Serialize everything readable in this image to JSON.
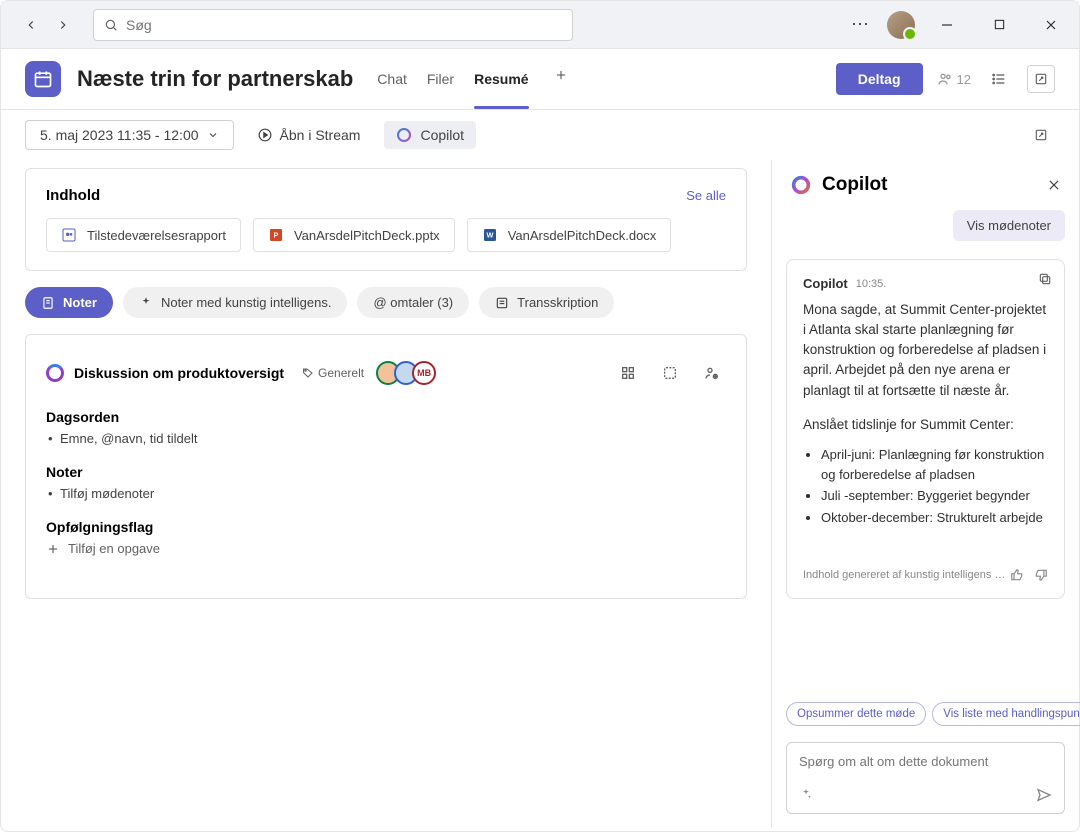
{
  "search": {
    "placeholder": "Søg"
  },
  "window": {
    "participants_count": "12"
  },
  "header": {
    "title": "Næste trin for partnerskab",
    "tabs": {
      "chat": "Chat",
      "files": "Filer",
      "recap": "Resumé"
    },
    "join": "Deltag"
  },
  "toolbar": {
    "date_range": "5. maj 2023 11:35 - 12:00",
    "open_stream": "Åbn i Stream",
    "copilot": "Copilot"
  },
  "content": {
    "heading": "Indhold",
    "see_all": "Se alle",
    "files": [
      {
        "name": "Tilstedeværelsesrapport",
        "type": "teams"
      },
      {
        "name": "VanArsdelPitchDeck.pptx",
        "type": "pptx"
      },
      {
        "name": "VanArsdelPitchDeck.docx",
        "type": "docx"
      }
    ]
  },
  "pills": {
    "notes": "Noter",
    "ai_notes": "Noter med kunstig intelligens.",
    "mentions": "@ omtaler (3)",
    "transcript": "Transskription"
  },
  "notes": {
    "title": "Diskussion om produktoversigt",
    "tag": "Generelt",
    "avatars": {
      "mb": "MB"
    },
    "sections": {
      "agenda_h": "Dagsorden",
      "agenda_item": "Emne, @navn, tid tildelt",
      "notes_h": "Noter",
      "notes_item": "Tilføj mødenoter",
      "followup_h": "Opfølgningsflag",
      "add_task": "Tilføj en opgave"
    }
  },
  "copilot": {
    "title": "Copilot",
    "show_notes": "Vis mødenoter",
    "msg_name": "Copilot",
    "msg_time": "10:35.",
    "msg_body": "Mona sagde, at Summit Center-projektet i Atlanta skal starte planlægning før konstruktion og forberedelse af pladsen i april. Arbejdet på den nye arena er planlagt til at fortsætte til næste år.",
    "timeline_h": "Anslået tidslinje for Summit Center:",
    "timeline": [
      "April-juni: Planlægning før konstruktion og forberedelse af pladsen",
      "Juli -september: Byggeriet begynder",
      "Oktober-december: Strukturelt arbejde"
    ],
    "disclaimer": "Indhold genereret af kunstig intelligens …",
    "suggestions": {
      "s1": "Opsummer dette møde",
      "s2": "Vis liste med handlingspunkter"
    },
    "placeholder": "Spørg om alt om dette dokument"
  }
}
